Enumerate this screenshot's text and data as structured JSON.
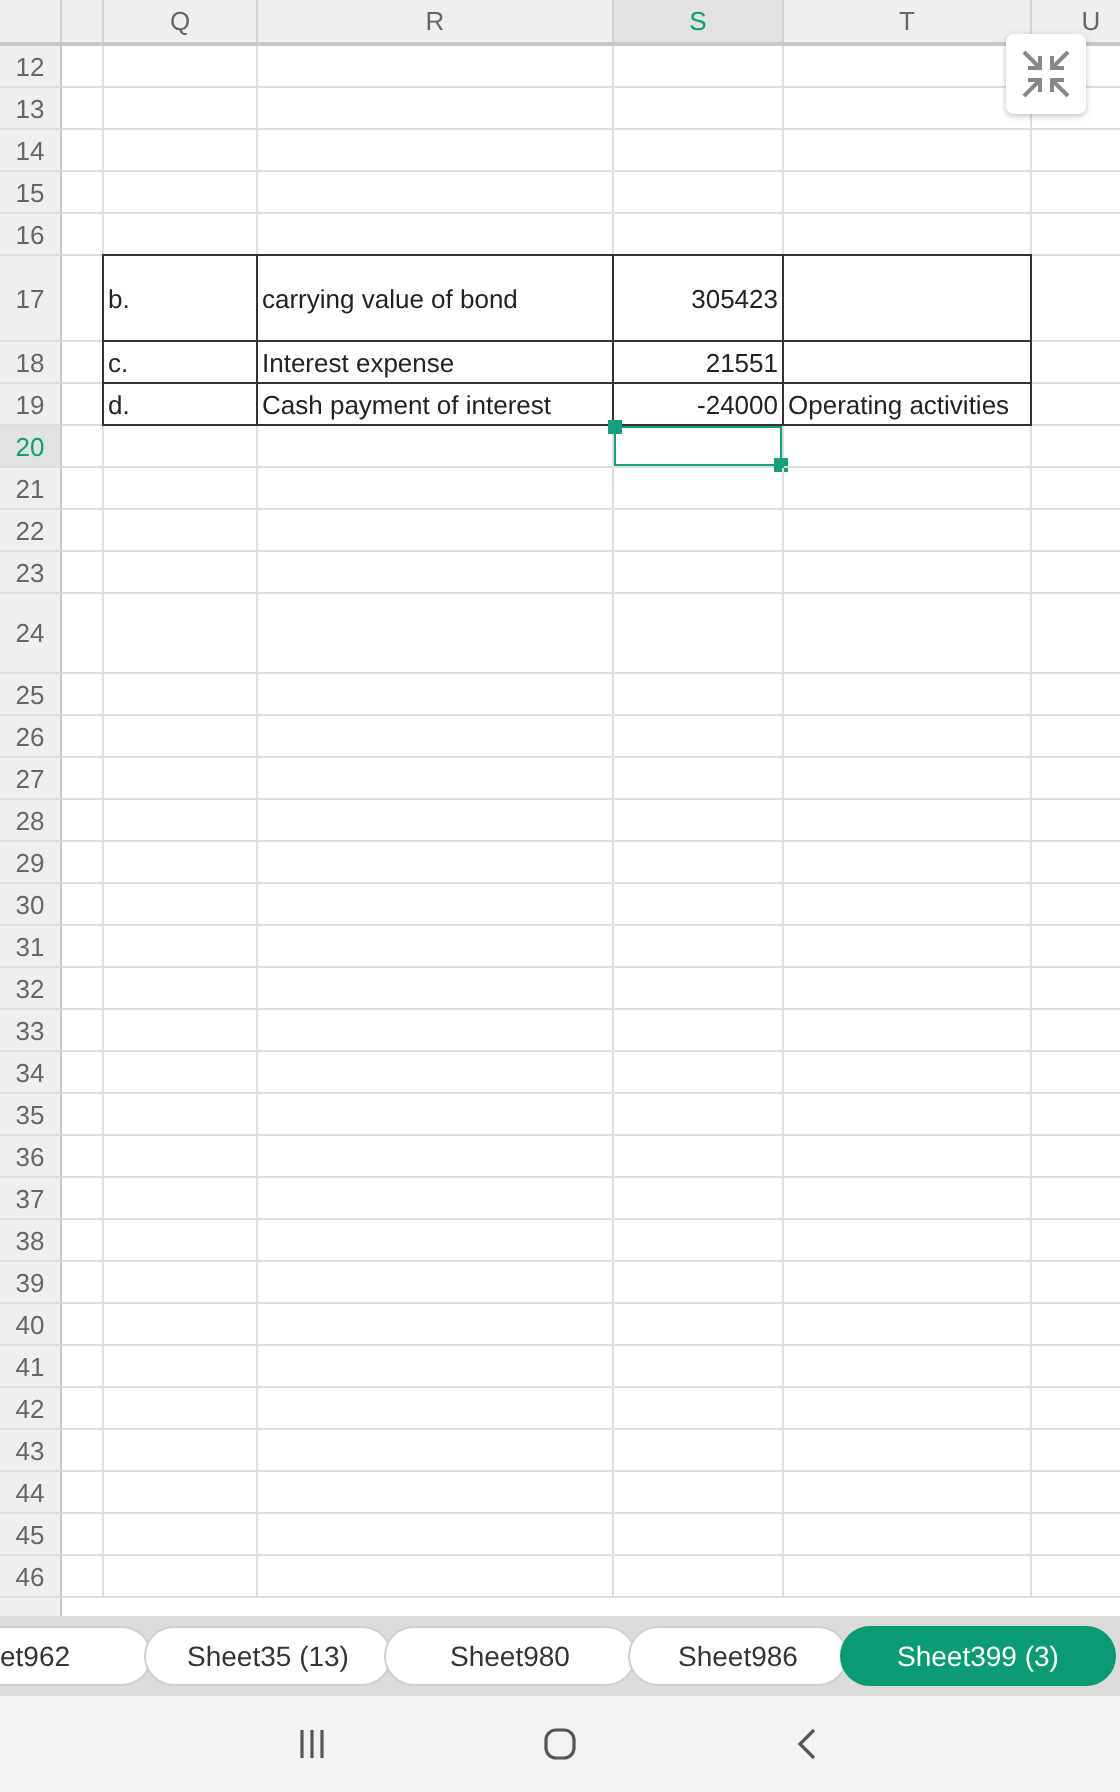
{
  "columns": [
    {
      "label": "Q",
      "selected": false
    },
    {
      "label": "R",
      "selected": false
    },
    {
      "label": "S",
      "selected": true
    },
    {
      "label": "T",
      "selected": false
    },
    {
      "label": "U",
      "selected": false
    }
  ],
  "rows": [
    {
      "number": "12",
      "selected": false
    },
    {
      "number": "13",
      "selected": false
    },
    {
      "number": "14",
      "selected": false
    },
    {
      "number": "15",
      "selected": false
    },
    {
      "number": "16",
      "selected": false
    },
    {
      "number": "17",
      "selected": false,
      "bordered": true,
      "cells": [
        "b.",
        "carrying value of bond",
        "305423",
        null
      ]
    },
    {
      "number": "18",
      "selected": false,
      "bordered": true,
      "cells": [
        "c.",
        "Interest expense",
        "21551",
        null
      ]
    },
    {
      "number": "19",
      "selected": false,
      "bordered": true,
      "cells": [
        "d.",
        "Cash payment of interest",
        "-24000",
        "Operating activities"
      ]
    },
    {
      "number": "20",
      "selected": true
    },
    {
      "number": "21",
      "selected": false
    },
    {
      "number": "22",
      "selected": false
    },
    {
      "number": "23",
      "selected": false
    },
    {
      "number": "24",
      "selected": false
    },
    {
      "number": "25",
      "selected": false
    },
    {
      "number": "26",
      "selected": false
    },
    {
      "number": "27",
      "selected": false
    },
    {
      "number": "28",
      "selected": false
    },
    {
      "number": "29",
      "selected": false
    },
    {
      "number": "30",
      "selected": false
    },
    {
      "number": "31",
      "selected": false
    },
    {
      "number": "32",
      "selected": false
    },
    {
      "number": "33",
      "selected": false
    },
    {
      "number": "34",
      "selected": false
    },
    {
      "number": "35",
      "selected": false
    },
    {
      "number": "36",
      "selected": false
    },
    {
      "number": "37",
      "selected": false
    },
    {
      "number": "38",
      "selected": false
    },
    {
      "number": "39",
      "selected": false
    },
    {
      "number": "40",
      "selected": false
    },
    {
      "number": "41",
      "selected": false
    },
    {
      "number": "42",
      "selected": false
    },
    {
      "number": "43",
      "selected": false
    },
    {
      "number": "44",
      "selected": false
    },
    {
      "number": "45",
      "selected": false
    },
    {
      "number": "46",
      "selected": false
    }
  ],
  "sheet_tabs": [
    {
      "label": "et962",
      "selected": false
    },
    {
      "label": "Sheet35 (13)",
      "selected": false
    },
    {
      "label": "Sheet980",
      "selected": false
    },
    {
      "label": "Sheet986",
      "selected": false
    },
    {
      "label": "Sheet399 (3)",
      "selected": true
    }
  ]
}
